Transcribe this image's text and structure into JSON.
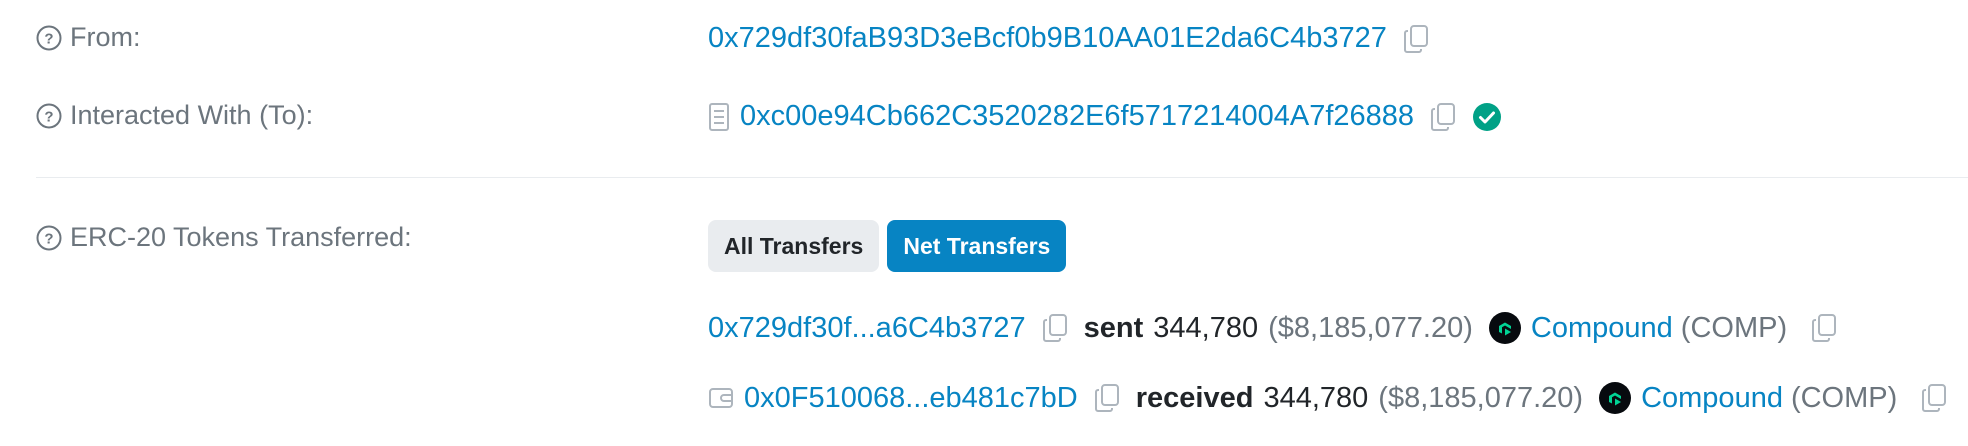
{
  "from": {
    "label": "From:",
    "address": "0x729df30faB93D3eBcf0b9B10AA01E2da6C4b3727"
  },
  "interacted_with": {
    "label": "Interacted With (To):",
    "address": "0xc00e94Cb662C3520282E6f5717214004A7f26888"
  },
  "erc20": {
    "label": "ERC-20 Tokens Transferred:",
    "tabs": [
      "All Transfers",
      "Net Transfers"
    ],
    "active_tab": "Net Transfers",
    "transfers": [
      {
        "address": "0x729df30f...a6C4b3727",
        "action": "sent",
        "amount": "344,780",
        "usd": "($8,185,077.20)",
        "token_name": "Compound",
        "token_symbol": "(COMP)"
      },
      {
        "address": "0x0F510068...eb481c7bD",
        "action": "received",
        "amount": "344,780",
        "usd": "($8,185,077.20)",
        "token_name": "Compound",
        "token_symbol": "(COMP)"
      }
    ]
  },
  "colors": {
    "link": "#0784c3",
    "verified": "#00a186",
    "muted": "#6c757d"
  },
  "icons": [
    "question-circle-icon",
    "copy-icon",
    "verified-check-icon",
    "contract-doc-icon",
    "wallet-icon",
    "compound-token-icon"
  ]
}
